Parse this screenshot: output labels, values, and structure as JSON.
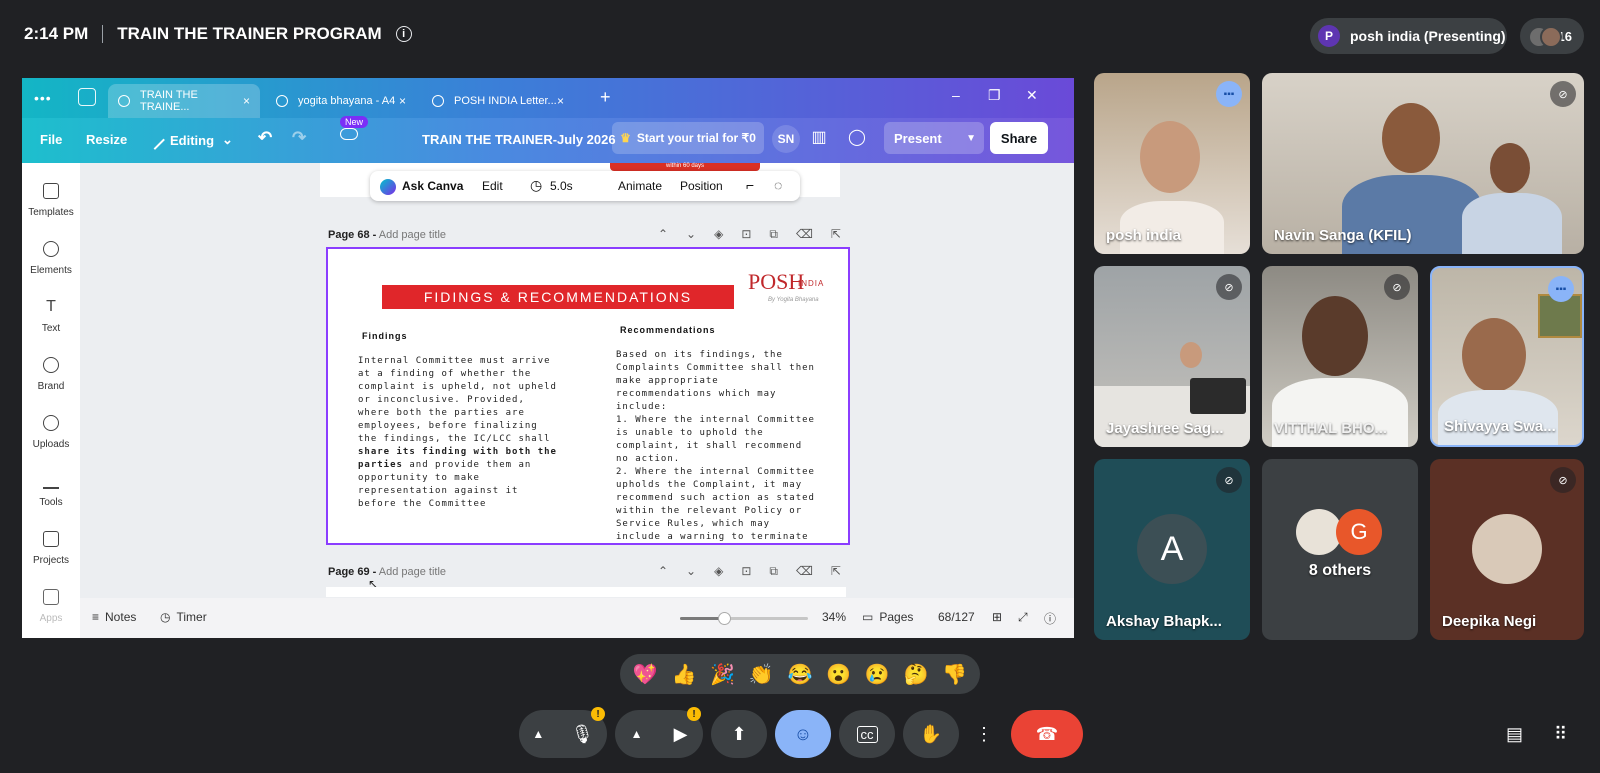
{
  "meet": {
    "time": "2:14 PM",
    "meeting_title": "TRAIN THE TRAINER PROGRAM",
    "info_icon": "i",
    "presenter_initial": "P",
    "presenting_label": "posh india (Presenting)",
    "participant_count": "16"
  },
  "browser": {
    "menu_dots": "•••",
    "tabs": [
      {
        "label": "TRAIN THE TRAINE...",
        "close": "×"
      },
      {
        "label": "yogita bhayana - A4",
        "close": "×"
      },
      {
        "label": "POSH INDIA Letter...",
        "close": "×"
      }
    ],
    "new_tab": "+",
    "minimize": "–",
    "restore": "❐",
    "close": "✕"
  },
  "canva": {
    "file": "File",
    "resize": "Resize",
    "editing": "Editing",
    "undo": "↶",
    "redo": "↷",
    "new_badge": "New",
    "doc_title": "TRAIN THE TRAINER-July 2026",
    "trial": "Start your trial for ₹0",
    "user_initials": "SN",
    "present": "Present",
    "share": "Share",
    "sidebar": [
      "Templates",
      "Elements",
      "Text",
      "Brand",
      "Uploads",
      "Tools",
      "Projects",
      "Apps"
    ],
    "top_strip_text": "within 60 days",
    "context_toolbar": {
      "ask": "Ask Canva",
      "edit": "Edit",
      "duration": "5.0s",
      "animate": "Animate",
      "position": "Position"
    },
    "page68": {
      "num": "Page 68 -",
      "placeholder": "Add page title"
    },
    "page69": {
      "num": "Page 69 -",
      "placeholder": "Add page title"
    },
    "slide": {
      "title": "FIDINGS & RECOMMENDATIONS",
      "logo": "POSH",
      "logo_sub": "INDIA",
      "logo_by": "By Yogita Bhayana",
      "findings_head": "Findings",
      "findings_text_1": "Internal Committee must arrive at a finding of whether the complaint is upheld, not upheld or inconclusive. Provided, where both the parties are employees, before finalizing the findings, the IC/LCC shall ",
      "findings_bold": "share its finding with both the parties",
      "findings_text_2": " and provide them an opportunity to make representation against it before the Committee",
      "recs_head": "Recommendations",
      "recs_text": "Based on its findings, the Complaints Committee shall then make appropriate recommendations which may include:",
      "recs_item1": " 1. Where the internal Committee is unable to uphold the complaint, it shall recommend no action.",
      "recs_item2": "2. Where the internal  Committee upholds the Complaint, it may recommend such action as stated within the relevant Policy or Service Rules, which may include a warning to terminate"
    },
    "footer": {
      "notes": "Notes",
      "timer": "Timer",
      "zoom": "34%",
      "zoom_level": 0.34,
      "pages": "Pages",
      "page_count": "68/127"
    }
  },
  "participants": [
    {
      "name": "posh india"
    },
    {
      "name": "Navin Sanga (KFIL)"
    },
    {
      "name": "Jayashree Sag..."
    },
    {
      "name": "VITTHAL BHO..."
    },
    {
      "name": "Shivayya Swa..."
    },
    {
      "name": "Akshay Bhapk...",
      "initial": "A"
    },
    {
      "name": "8 others",
      "initial": "G"
    },
    {
      "name": "Deepika Negi"
    }
  ],
  "reactions": [
    "💖",
    "👍",
    "🎉",
    "👏",
    "😂",
    "😮",
    "😢",
    "🤔",
    "👎"
  ],
  "controls": {
    "warn": "!"
  }
}
